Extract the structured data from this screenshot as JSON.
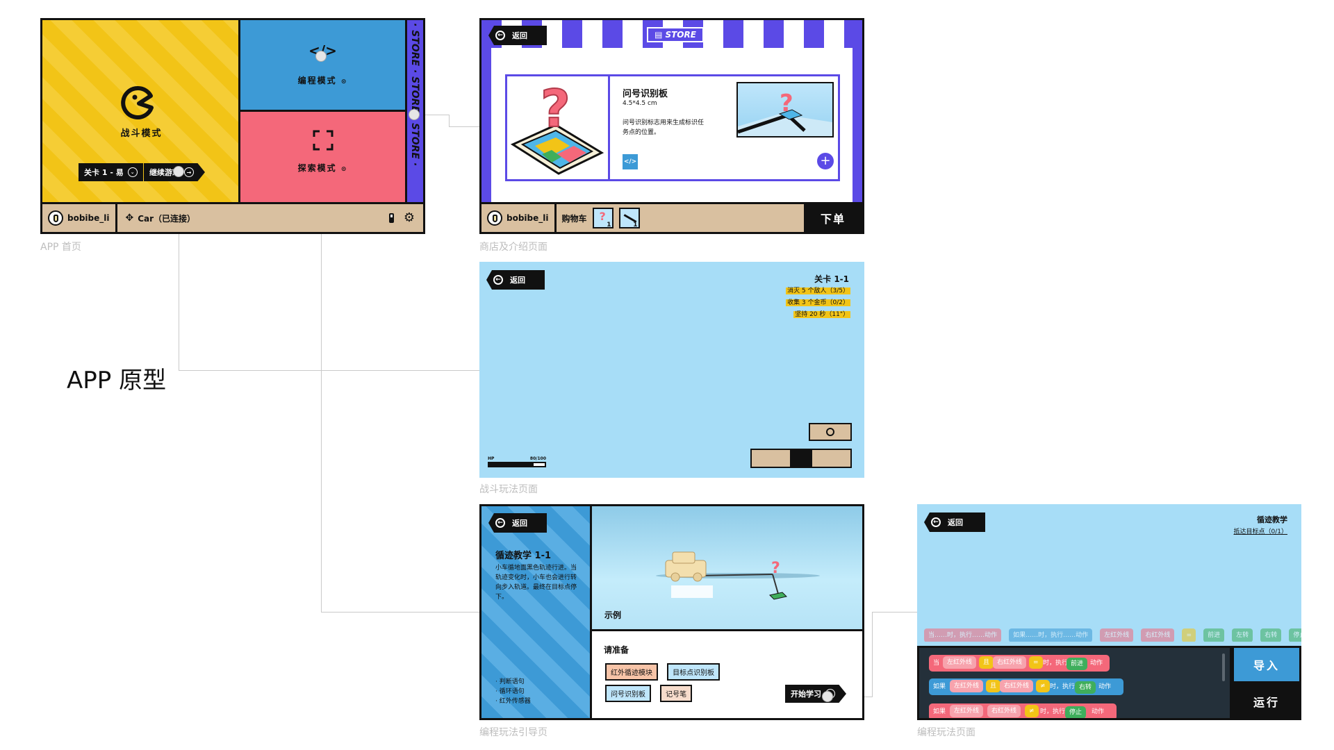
{
  "page_title": "APP 原型",
  "captions": {
    "home": "APP 首页",
    "store": "商店及介绍页面",
    "battle": "战斗玩法页面",
    "guide": "编程玩法引导页",
    "coding": "编程玩法页面"
  },
  "home": {
    "battle_label": "战斗模式",
    "level_button": "关卡 1 - 易",
    "continue_button": "继续游戏",
    "program_label": "编程模式",
    "explore_label": "探索模式",
    "store_strip": "· STORE · STORE · STORE ·",
    "user_name": "bobibe_li",
    "car_status": "Car（已连接）"
  },
  "store": {
    "back_label": "返回",
    "store_badge": "STORE",
    "product_title": "问号识别板",
    "product_size": "4.5*4.5 cm",
    "product_desc": "问号识别标志用来生成标识任务点的位置。",
    "user_name": "bobibe_li",
    "cart_label": "购物车",
    "cart_items": [
      {
        "count": "1"
      },
      {
        "count": "1"
      }
    ],
    "order_button": "下单"
  },
  "battle": {
    "back_label": "返回",
    "level_title": "关卡 1-1",
    "objectives": [
      "消灭 5 个敌人（3/5）",
      "收集 3 个金币（0/2）",
      "坚持 20 秒（11\"）"
    ],
    "hp_label": "HP",
    "hp_value": "80/100",
    "hp_fraction": 0.8
  },
  "guide": {
    "back_label": "返回",
    "lesson_title": "循迹教学 1-1",
    "lesson_desc": "小车循地面黑色轨迹行进。当轨迹变化时，小车也会进行转向步入轨道。最终在目标点停下。",
    "topics": [
      "· 判断语句",
      "· 循环语句",
      "· 红外传感器"
    ],
    "example_label": "示例",
    "prepare_title": "请准备",
    "prepare_items": [
      "红外循迹模块",
      "目标点识别板",
      "问号识别板",
      "记号笔"
    ],
    "start_button": "开始学习"
  },
  "coding": {
    "back_label": "返回",
    "title": "循迹教学",
    "objective": "抵达目标点（0/1）",
    "palette": [
      "当……时，执行……动作",
      "如果……时，执行……动作",
      "左红外线",
      "右红外线",
      "=",
      "前进",
      "左转",
      "右转",
      "停止"
    ],
    "import_button": "导入",
    "run_button": "运行",
    "code_lines": [
      [
        "当",
        "左红外线",
        "且",
        "右红外线",
        "=",
        "时，执行",
        "前进",
        "动作"
      ],
      [
        "如果",
        "左红外线",
        "且",
        "右红外线",
        "≠",
        "时，执行",
        "右转",
        "动作"
      ],
      [
        "如果",
        "左红外线",
        "右红外线",
        "≠",
        "时，执行",
        "停止",
        "动作"
      ]
    ]
  },
  "colors": {
    "yellow": "#f2c417",
    "blue": "#3d9ad6",
    "red": "#f4687a",
    "tan": "#d9c0a0",
    "sky": "#a7ddf7",
    "purple": "#5b4ae6"
  }
}
